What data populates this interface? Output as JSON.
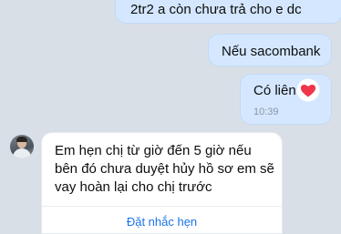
{
  "messages": [
    {
      "direction": "outgoing",
      "text": "2tr2 a còn chưa trả cho e dc"
    },
    {
      "direction": "outgoing",
      "text": "Nếu sacombank"
    },
    {
      "direction": "outgoing",
      "text": "Có liên",
      "time": "10:39",
      "reaction": "heart-reaction-icon"
    },
    {
      "direction": "incoming",
      "text": "Em hẹn chị từ giờ đến 5 giờ nếu bên đó chưa duyệt hủy hồ sơ em sẽ vay hoàn lại cho chị trước",
      "action_label": "Đặt nhắc hẹn"
    }
  ],
  "colors": {
    "background": "#d9dfe7",
    "outgoing_bubble": "#d4e7ff",
    "incoming_bubble": "#ffffff",
    "link": "#1a73e8",
    "reaction": "#f0354b"
  }
}
